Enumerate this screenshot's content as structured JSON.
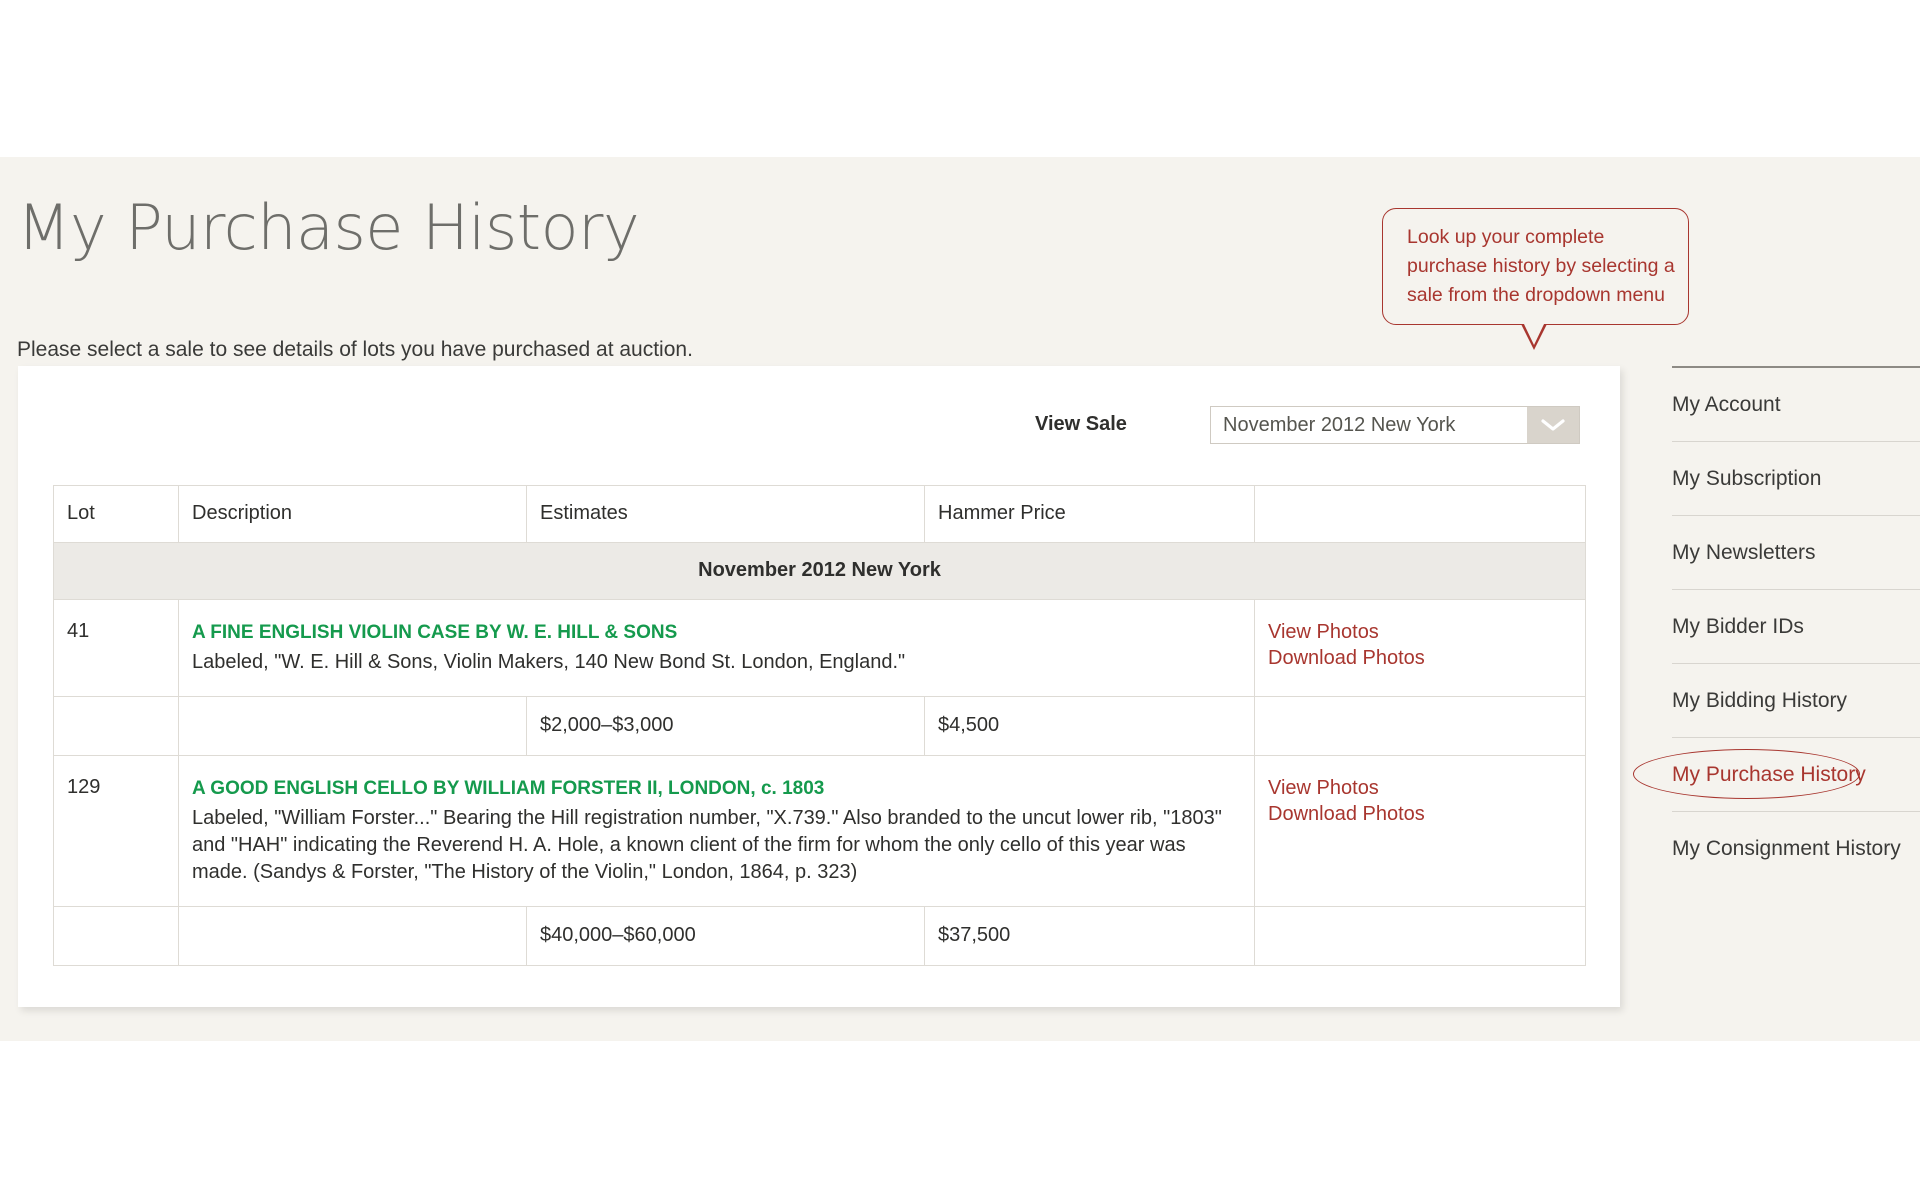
{
  "page": {
    "title": "My Purchase History",
    "subtitle": "Please select a sale to see details of lots you have purchased at auction."
  },
  "callout": {
    "text": "Look up your complete purchase history by selecting a sale from the dropdown menu",
    "color": "#a8362f"
  },
  "controls": {
    "view_sale_label": "View Sale",
    "selected_sale": "November 2012 New York",
    "chevron_icon": "chevron-down-icon"
  },
  "table": {
    "headers": [
      "Lot",
      "Description",
      "Estimates",
      "Hammer Price",
      ""
    ],
    "sale_band": "November 2012 New York",
    "rows": [
      {
        "lot": "41",
        "title": "A FINE ENGLISH VIOLIN CASE BY W. E. HILL & SONS",
        "body": "Labeled, \"W. E. Hill & Sons, Violin Makers, 140 New Bond St. London, England.\"",
        "view_photos": "View Photos",
        "download_photos": "Download Photos",
        "estimates": "$2,000–$3,000",
        "hammer_price": "$4,500"
      },
      {
        "lot": "129",
        "title": "A GOOD ENGLISH CELLO BY WILLIAM FORSTER II, LONDON, c. 1803",
        "body": "Labeled, \"William Forster...\"\nBearing the Hill registration number, \"X.739.\" Also branded to the uncut lower rib, \"1803\" and \"HAH\" indicating the Reverend H. A. Hole, a known client of the firm for whom the only cello of this year was made. (Sandys & Forster, \"The History of the Violin,\" London, 1864, p. 323)",
        "view_photos": "View Photos",
        "download_photos": "Download Photos",
        "estimates": "$40,000–$60,000",
        "hammer_price": "$37,500"
      }
    ]
  },
  "sidebar": {
    "items": [
      {
        "label": "My Account",
        "active": false
      },
      {
        "label": "My Subscription",
        "active": false
      },
      {
        "label": "My Newsletters",
        "active": false
      },
      {
        "label": "My Bidder IDs",
        "active": false
      },
      {
        "label": "My Bidding History",
        "active": false
      },
      {
        "label": "My Purchase History",
        "active": true
      },
      {
        "label": "My Consignment History",
        "active": false
      }
    ]
  },
  "colors": {
    "page_background": "#f5f3ee",
    "accent_red": "#a8362f",
    "lot_title_green": "#159a4d",
    "band_grey": "#eceae6"
  }
}
